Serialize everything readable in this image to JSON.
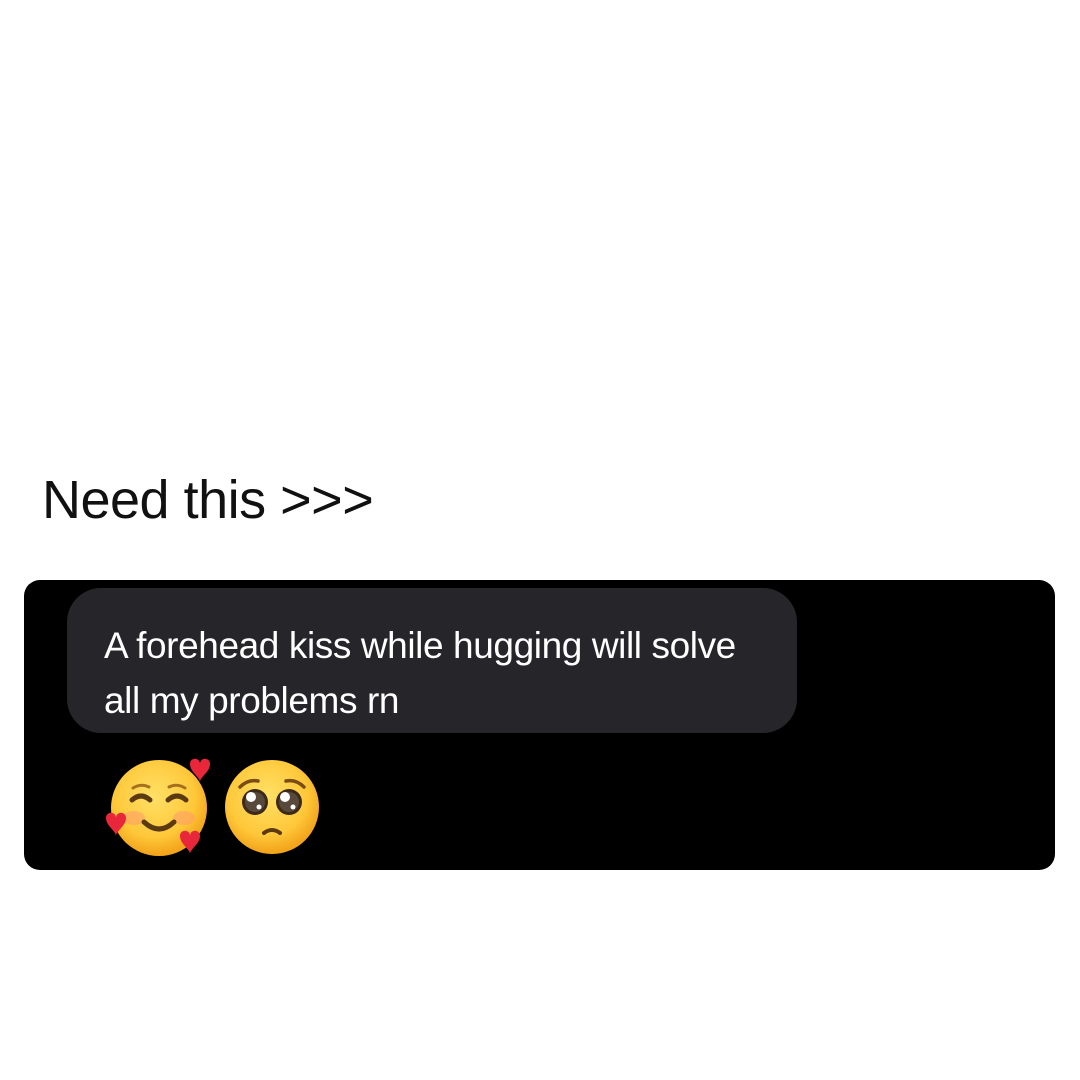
{
  "post": {
    "caption": "Need this >>>"
  },
  "chat": {
    "message_text": "A forehead kiss while hugging will solve all my problems rn",
    "emojis": [
      "smiling-face-with-hearts-emoji",
      "pleading-face-emoji"
    ],
    "colors": {
      "card_background": "#000000",
      "bubble_background": "#262529",
      "message_text": "#ffffff",
      "emoji_yellow": "#ffc83a",
      "heart_red": "#e8283a"
    }
  }
}
